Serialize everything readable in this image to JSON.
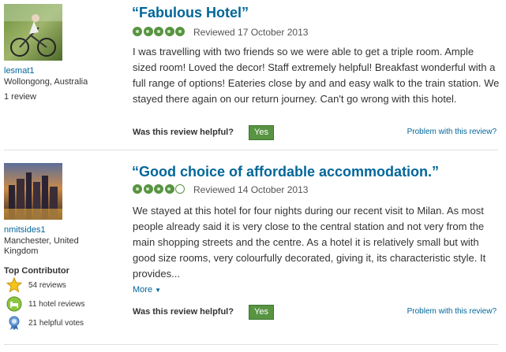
{
  "reviews": [
    {
      "username": "lesmat1",
      "location": "Wollongong, Australia",
      "review_count": "1 review",
      "title": "“Fabulous Hotel”",
      "bubbles": 5,
      "reviewed_date": "Reviewed 17 October 2013",
      "body": "I was travelling with two friends so we were able to get a triple room. Ample sized room! Loved the decor! Staff extremely helpful! Breakfast wonderful with a full range of options! Eateries close by and and easy walk to the train station. We stayed there again on our return journey. Can't go wrong with this hotel.",
      "helpful_question": "Was this review helpful?",
      "yes_label": "Yes",
      "problem_link": "Problem with this review?"
    },
    {
      "username": "nmitsides1",
      "location": "Manchester, United Kingdom",
      "contributor_title": "Top Contributor",
      "badges": [
        {
          "icon": "star-badge-icon",
          "label": "54 reviews"
        },
        {
          "icon": "hotel-badge-icon",
          "label": "11 hotel reviews"
        },
        {
          "icon": "ribbon-badge-icon",
          "label": "21 helpful votes"
        }
      ],
      "title": "“Good choice of affordable accommodation.”",
      "bubbles": 4,
      "reviewed_date": "Reviewed 14 October 2013",
      "body": "We stayed at this hotel for four nights during our recent visit to Milan. As most people already said it is very close to the central station and not very from the main shopping streets and the centre. As a hotel it is relatively small but with good size rooms, very colourfully decorated, giving it, its characteristic style. It provides...",
      "more_label": "More",
      "helpful_question": "Was this review helpful?",
      "yes_label": "Yes",
      "problem_link": "Problem with this review?"
    }
  ],
  "colors": {
    "link": "#006699",
    "bubble_green": "#589442",
    "text": "#333333"
  }
}
